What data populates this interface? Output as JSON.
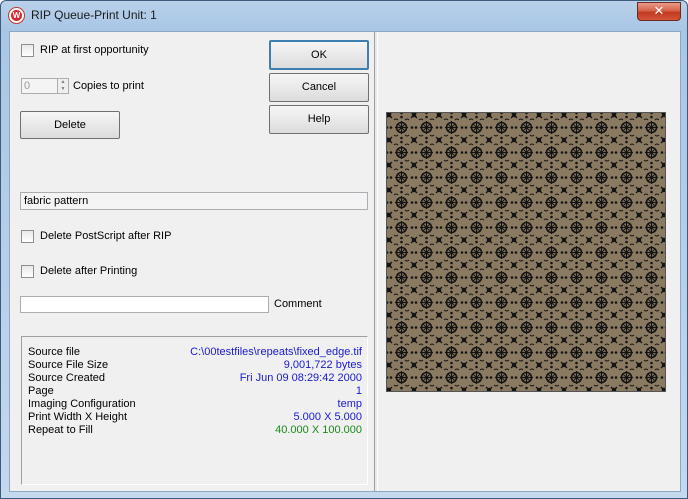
{
  "window": {
    "title": "RIP Queue-Print Unit: 1",
    "close_glyph": "✕",
    "app_icon_letter": "W"
  },
  "form": {
    "rip_first_label": "RIP at first opportunity",
    "rip_first_checked": false,
    "copies_value": "0",
    "copies_label": "Copies to print",
    "delete_label": "Delete",
    "job_name": "fabric pattern",
    "delete_ps_label": "Delete PostScript after RIP",
    "delete_ps_checked": false,
    "delete_after_print_label": "Delete after Printing",
    "delete_after_print_checked": false,
    "comment_value": "",
    "comment_label": "Comment"
  },
  "buttons": {
    "ok": "OK",
    "cancel": "Cancel",
    "help": "Help"
  },
  "info": {
    "source_file_label": "Source file",
    "source_file_value": "C:\\00testfiles\\repeats\\fixed_edge.tif",
    "source_size_label": "Source File Size",
    "source_size_value": "9,001,722 bytes",
    "source_created_label": "Source Created",
    "source_created_value": "Fri Jun 09 08:29:42 2000",
    "page_label": "Page",
    "page_value": "1",
    "imaging_label": "Imaging Configuration",
    "imaging_value": "temp",
    "print_size_label": "Print Width X Height",
    "print_size_value": "5.000 X 5.000",
    "repeat_label": "Repeat to Fill",
    "repeat_value": "40.000 X 100.000"
  },
  "colors": {
    "value_blue": "#1a1ad0",
    "value_green": "#1a8a1a",
    "pattern_bg": "#8b7a62",
    "pattern_ink": "#141414"
  }
}
